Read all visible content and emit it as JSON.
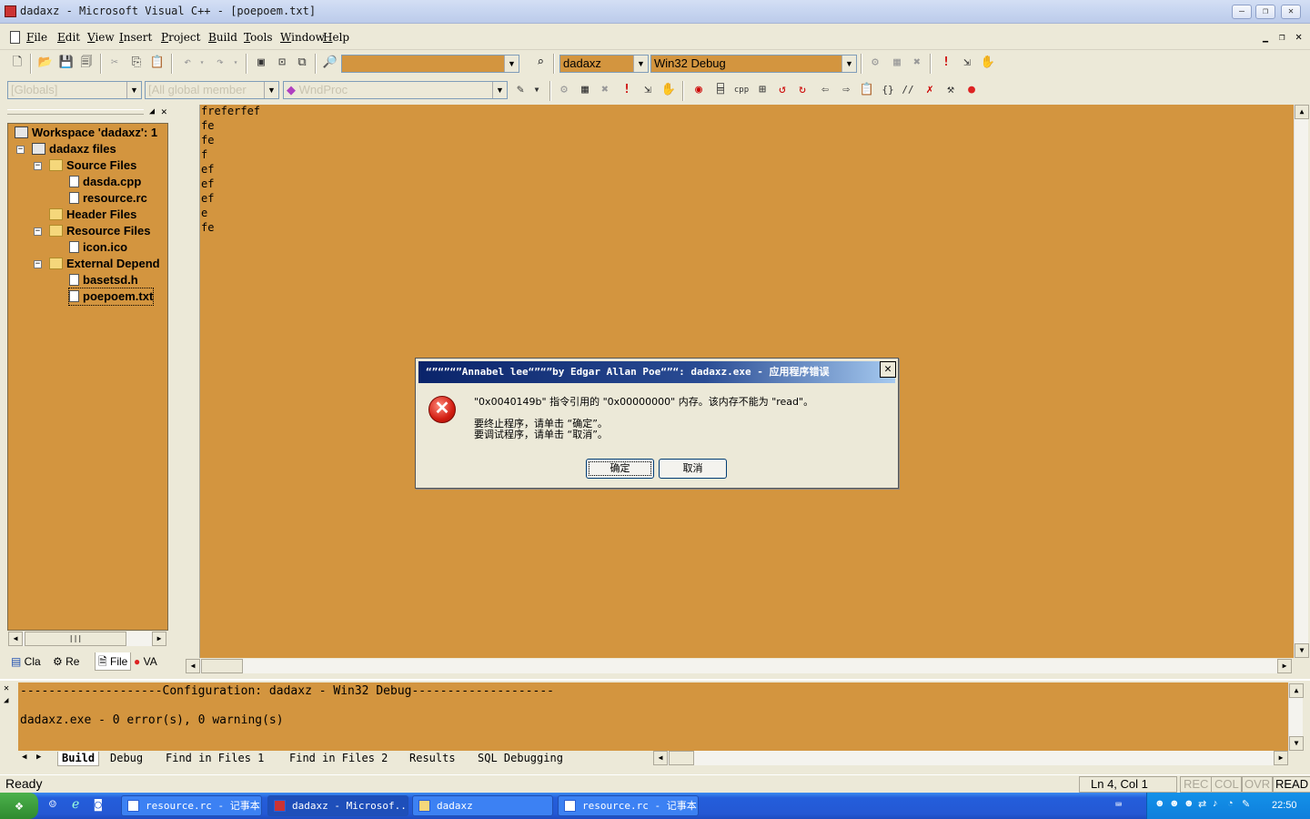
{
  "window": {
    "title": "dadaxz - Microsoft Visual C++ - [poepoem.txt]",
    "minimize": "—",
    "restore": "❐",
    "close": "✕"
  },
  "menu": {
    "items": [
      "File",
      "Edit",
      "View",
      "Insert",
      "Project",
      "Build",
      "Tools",
      "Window",
      "Help"
    ]
  },
  "toolbar": {
    "find_combo_value": "",
    "project_combo": "dadaxz",
    "config_combo": "Win32 Debug",
    "wizard": {
      "class_combo": "[Globals]",
      "members_combo": "[All global member",
      "function_combo": "WndProc"
    }
  },
  "workspace": {
    "items": [
      {
        "label": "Workspace 'dadaxz': 1",
        "icon": "workspace-icon"
      },
      {
        "label": "dadaxz files",
        "icon": "project-icon"
      },
      {
        "label": "Source Files",
        "icon": "folder-icon"
      },
      {
        "label": "dasda.cpp",
        "icon": "file-icon"
      },
      {
        "label": "resource.rc",
        "icon": "file-icon"
      },
      {
        "label": "Header Files",
        "icon": "folder-icon"
      },
      {
        "label": "Resource Files",
        "icon": "folder-icon"
      },
      {
        "label": "icon.ico",
        "icon": "file-icon"
      },
      {
        "label": "External Depend",
        "icon": "folder-icon"
      },
      {
        "label": "basetsd.h",
        "icon": "file-icon"
      },
      {
        "label": "poepoem.txt",
        "icon": "file-icon"
      }
    ],
    "tabs": [
      "Cla",
      "Re",
      "File",
      "VA"
    ]
  },
  "editor": {
    "lines": [
      "freferfef",
      "fe",
      "fe",
      "f",
      "ef",
      "ef",
      "ef",
      "e",
      "fe"
    ]
  },
  "output": {
    "lines": [
      "--------------------Configuration: dadaxz - Win32 Debug--------------------",
      "dadaxz.exe - 0 error(s), 0 warning(s)"
    ],
    "tabs": [
      "Build",
      "Debug",
      "Find in Files 1",
      "Find in Files 2",
      "Results",
      "SQL Debugging"
    ]
  },
  "status": {
    "text": "Ready",
    "position": "Ln 4, Col 1",
    "rec": "REC",
    "col": "COL",
    "ovr": "OVR",
    "read": "READ"
  },
  "dialog": {
    "title": "“”“”“”Annabel lee“”“”by Edgar Allan Poe“”“: dadaxz.exe - 应用程序错误",
    "close": "✕",
    "message": "\"0x0040149b\" 指令引用的 \"0x00000000\" 内存。该内存不能为 \"read\"。",
    "hint_terminate": "要终止程序，请单击 “确定”。",
    "hint_debug": "要调试程序，请单击 “取消”。",
    "ok_label": "确定",
    "cancel_label": "取消"
  },
  "taskbar": {
    "buttons": [
      "resource.rc - 记事本",
      "dadaxz - Microsof...",
      "dadaxz",
      "resource.rc - 记事本"
    ],
    "clock": "22:50"
  },
  "colors": {
    "editor_bg": "#d3953f",
    "dialog_title": "#0a246a",
    "taskbar": "#245edb"
  }
}
